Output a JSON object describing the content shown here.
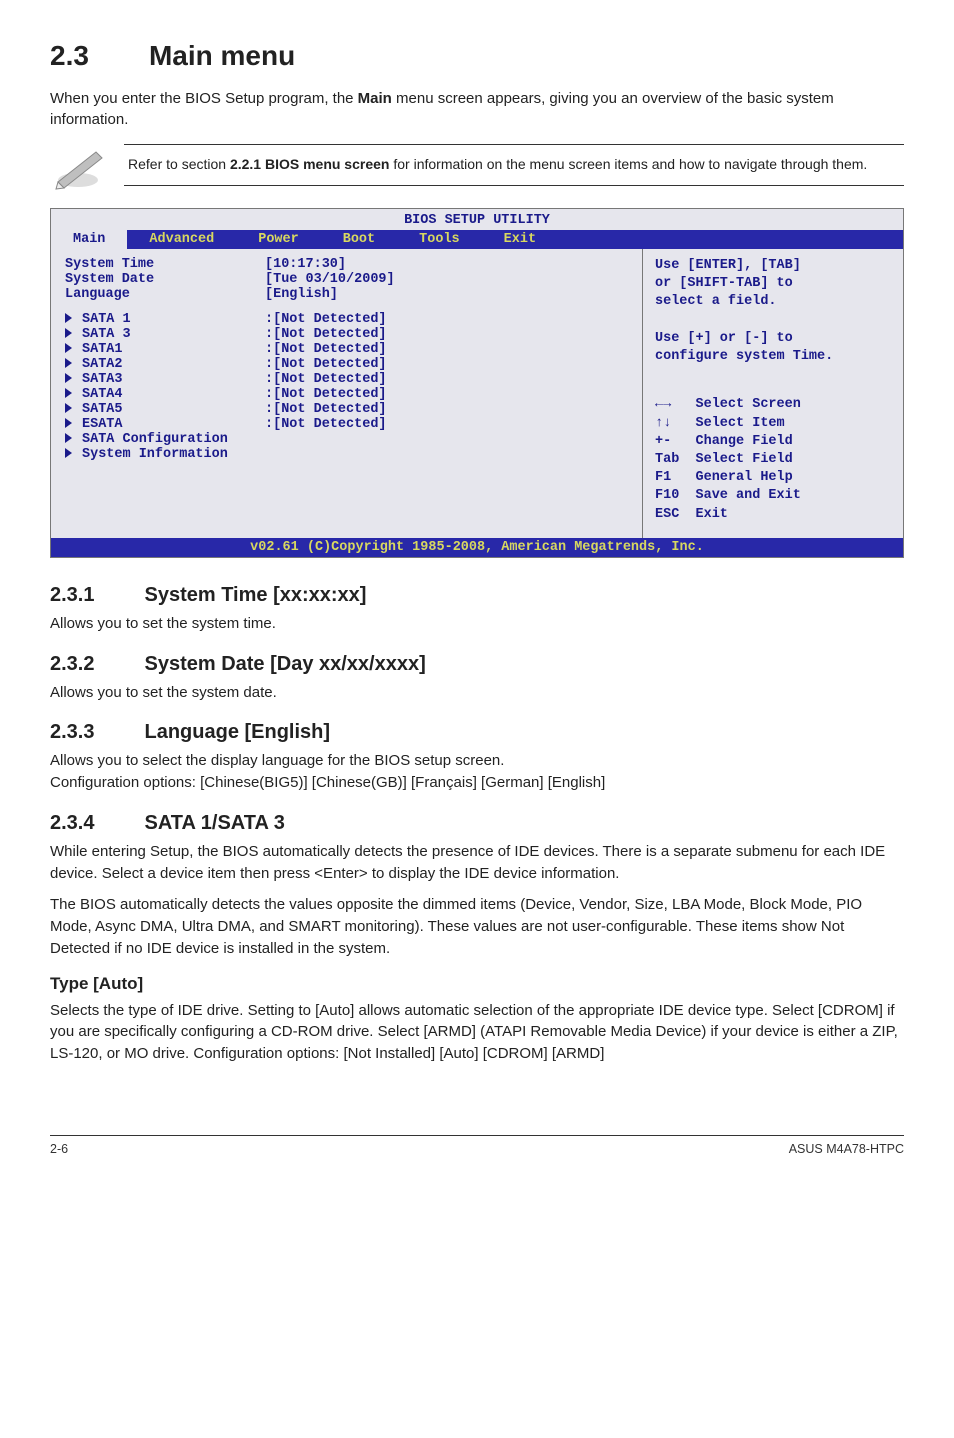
{
  "heading": {
    "num": "2.3",
    "title": "Main menu"
  },
  "intro_before_bold": "When you enter the BIOS Setup program, the ",
  "intro_bold": "Main",
  "intro_after_bold": " menu screen appears, giving you an overview of the basic system information.",
  "note_before": "Refer to section ",
  "note_bold": "2.2.1 BIOS menu screen",
  "note_after": " for information on the menu screen items and how to navigate through them.",
  "bios": {
    "title": "BIOS SETUP UTILITY",
    "tabs": [
      "Main",
      "Advanced",
      "Power",
      "Boot",
      "Tools",
      "Exit"
    ],
    "active_tab_index": 0,
    "sys_rows": [
      {
        "label": "System Time",
        "value": "[10:17:30]"
      },
      {
        "label": "System Date",
        "value": "[Tue 03/10/2009]"
      },
      {
        "label": "Language",
        "value": "[English]"
      }
    ],
    "dev_rows": [
      {
        "label": "SATA 1",
        "value": ":[Not Detected]"
      },
      {
        "label": "SATA 3",
        "value": ":[Not Detected]"
      },
      {
        "label": "SATA1",
        "value": ":[Not Detected]"
      },
      {
        "label": "SATA2",
        "value": ":[Not Detected]"
      },
      {
        "label": "SATA3",
        "value": ":[Not Detected]"
      },
      {
        "label": "SATA4",
        "value": ":[Not Detected]"
      },
      {
        "label": "SATA5",
        "value": ":[Not Detected]"
      },
      {
        "label": "ESATA",
        "value": ":[Not Detected]"
      },
      {
        "label": "SATA Configuration",
        "value": ""
      },
      {
        "label": "",
        "value": ""
      },
      {
        "label": "System Information",
        "value": ""
      }
    ],
    "help_top": "Use [ENTER], [TAB]\nor [SHIFT-TAB] to\nselect a field.\n\nUse [+] or [-] to\nconfigure system Time.",
    "help_keys": "←→   Select Screen\n↑↓   Select Item\n+-   Change Field\nTab  Select Field\nF1   General Help\nF10  Save and Exit\nESC  Exit",
    "footer": "v02.61 (C)Copyright 1985-2008, American Megatrends, Inc."
  },
  "sections": [
    {
      "num": "2.3.1",
      "title": "System Time [xx:xx:xx]",
      "paras": [
        "Allows you to set the system time."
      ]
    },
    {
      "num": "2.3.2",
      "title": "System Date [Day xx/xx/xxxx]",
      "paras": [
        "Allows you to set the system date."
      ]
    },
    {
      "num": "2.3.3",
      "title": "Language [English]",
      "paras": [
        "Allows you to select the display language for the BIOS setup screen.\nConfiguration options: [Chinese(BIG5)] [Chinese(GB)] [Français] [German] [English]"
      ]
    },
    {
      "num": "2.3.4",
      "title": "SATA 1/SATA 3",
      "paras": [
        "While entering Setup, the BIOS automatically detects the presence of IDE devices. There is a separate submenu for each IDE device. Select a device item then press <Enter> to display the IDE device information.",
        "The BIOS automatically detects the values opposite the dimmed items (Device, Vendor, Size, LBA Mode, Block Mode, PIO Mode, Async DMA, Ultra DMA, and SMART monitoring). These values are not user-configurable. These items show Not Detected if no IDE device is installed in the system."
      ]
    }
  ],
  "type_heading": "Type [Auto]",
  "type_para": "Selects the type of IDE drive. Setting to [Auto] allows automatic selection of the appropriate IDE device type. Select [CDROM] if you are specifically configuring a CD-ROM drive. Select [ARMD] (ATAPI Removable Media Device) if your device is either a ZIP, LS-120, or MO drive. Configuration options: [Not Installed] [Auto] [CDROM] [ARMD]",
  "footer_left": "2-6",
  "footer_right": "ASUS M4A78-HTPC"
}
